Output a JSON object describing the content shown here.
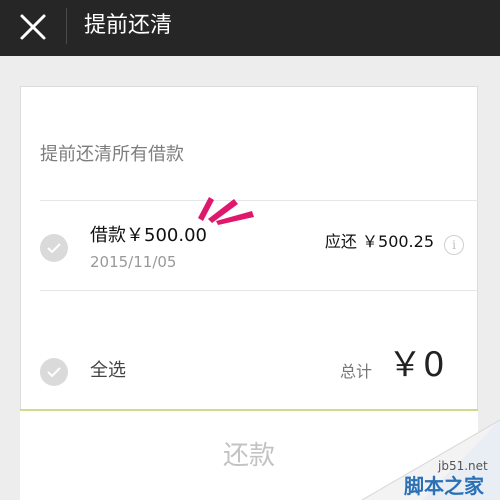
{
  "header": {
    "title": "提前还清"
  },
  "section": {
    "title": "提前还清所有借款"
  },
  "loan": {
    "amount_label": "借款￥500.00",
    "date": "2015/11/05",
    "due_label": "应还 ￥500.25",
    "info_glyph": "i"
  },
  "footer": {
    "select_all_label": "全选",
    "total_label": "总计",
    "total_value": "￥0"
  },
  "actions": {
    "repay_label": "还款"
  },
  "watermark": {
    "site": "jb51.net",
    "brand": "脚本之家"
  },
  "colors": {
    "header_bg": "#262626",
    "accent_line": "#cbdc8a",
    "highlight_marks": "#e0186c",
    "disabled_text": "#c3c3c3"
  }
}
